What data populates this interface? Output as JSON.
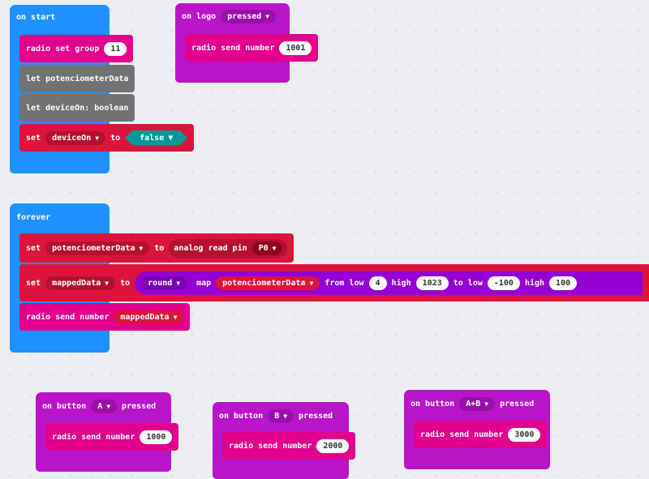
{
  "on_start": {
    "label": "on start",
    "radio_set_group": "radio set group",
    "group_value": "11",
    "let_pot": "let potenciometerData",
    "let_device": "let deviceOn: boolean",
    "set_label": "set",
    "set_var": "deviceOn",
    "to_label": "to",
    "bool_value": "false"
  },
  "on_logo": {
    "label": "on logo",
    "event": "pressed",
    "send_label": "radio send number",
    "send_value": "1001"
  },
  "forever": {
    "label": "forever",
    "set1_label": "set",
    "set1_var": "potenciometerData",
    "set1_to": "to",
    "analog_label": "analog read pin",
    "pin": "P0",
    "set2_label": "set",
    "set2_var": "mappedData",
    "set2_to": "to",
    "round_label": "round",
    "map_label": "map",
    "map_var": "potenciometerData",
    "from_low_label": "from low",
    "from_low_value": "4",
    "high_label1": "high",
    "high_value1": "1023",
    "to_low_label": "to low",
    "to_low_value": "-100",
    "high_label2": "high",
    "high_value2": "100",
    "send_label": "radio send number",
    "send_var": "mappedData"
  },
  "button_a": {
    "label": "on button",
    "button": "A",
    "event": "pressed",
    "send_label": "radio send number",
    "send_value": "1000"
  },
  "button_b": {
    "label": "on button",
    "button": "B",
    "event": "pressed",
    "send_label": "radio send number",
    "send_value": "2000"
  },
  "button_ab": {
    "label": "on button",
    "button": "A+B",
    "event": "pressed",
    "send_label": "radio send number",
    "send_value": "3000"
  },
  "colors": {
    "basic": "#1e90ff",
    "radio": "#e3008c",
    "variables": "#dc143c",
    "input": "#b915c8",
    "math": "#9400d3",
    "logic": "#009a99"
  }
}
